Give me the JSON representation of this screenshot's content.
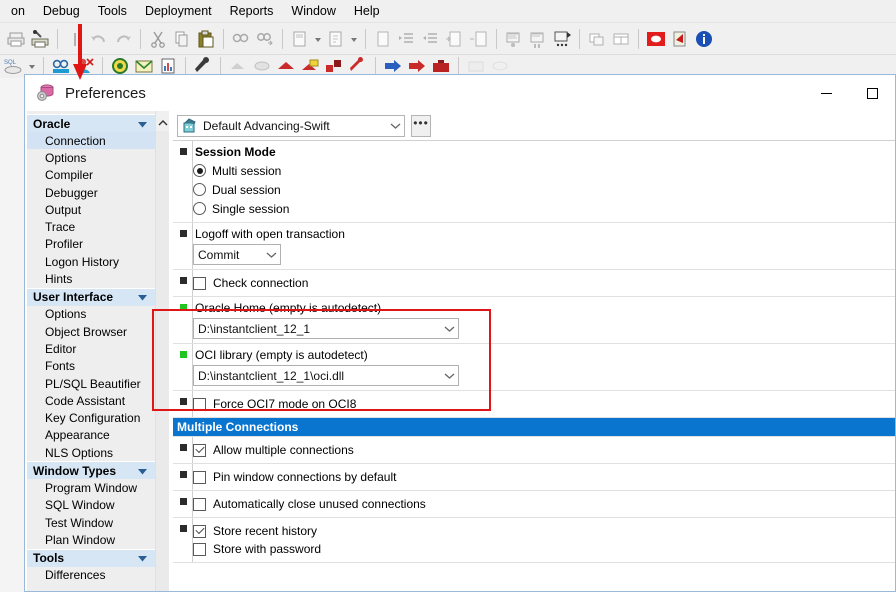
{
  "app": {
    "menubar": [
      {
        "label": "on",
        "truncated": true
      },
      {
        "label": "Debug",
        "accel": "D"
      },
      {
        "label": "Tools",
        "accel": "T"
      },
      {
        "label": "Deployment",
        "accel": "p"
      },
      {
        "label": "Reports",
        "accel": "R"
      },
      {
        "label": "Window",
        "accel": "W"
      },
      {
        "label": "Help",
        "accel": "H"
      }
    ],
    "toolbar_primary_icons": [
      "print-icon",
      "print-setup-icon",
      "separator",
      "sql-bar-icon",
      "undo-icon",
      "redo-icon",
      "separator",
      "cut-icon",
      "copy-icon",
      "paste-icon",
      "separator",
      "find-icon",
      "find-next-icon",
      "separator",
      "new-document-icon",
      "new-document-dropdown-icon",
      "open-document-icon",
      "open-document-dropdown-icon",
      "separator",
      "document-icon",
      "indent-icon",
      "outdent-icon",
      "comment-icon",
      "uncomment-icon",
      "separator",
      "execute-icon",
      "execute-step-icon",
      "execute-options-icon",
      "separator",
      "tile-windows-icon",
      "cascade-windows-icon",
      "separator",
      "oracle-icon",
      "pdf-export-icon",
      "about-icon"
    ],
    "toolbar_secondary_icons": [
      "sql-window-icon",
      "sql-dropdown-icon",
      "separator",
      "find-objects-icon",
      "session-icon",
      "separator",
      "compile-icon",
      "mail-icon",
      "report-icon",
      "separator",
      "tools-wrench-icon",
      "separator",
      "gray-shape-icon",
      "gray-oval-icon",
      "red-object-icon",
      "red-yellow-icon",
      "red-blocks-icon",
      "red-tool-icon",
      "separator",
      "blue-arrow-icon",
      "red-arrow-icon",
      "red-briefcase-icon",
      "separator",
      "faded-icon-a",
      "faded-icon-b"
    ],
    "annotation": {
      "arrow": "red-down-arrow",
      "arrow_color": "#e01515",
      "highlight_box_color": "#e01515"
    }
  },
  "dialog": {
    "title": "Preferences",
    "title_icon": "preferences-database-icon",
    "window_buttons": {
      "minimize": "minimize-icon",
      "maximize": "maximize-icon"
    },
    "profile": {
      "icon": "profile-icon",
      "value": "Default Advancing-Swift",
      "dropdown_icon": "chevron-down-icon",
      "more_button_label": "•••"
    },
    "sidebar": {
      "scroll_up_icon": "chevron-up-icon",
      "groups": [
        {
          "name": "Oracle",
          "caret_icon": "caret-down-icon",
          "items": [
            {
              "label": "Connection",
              "selected": true
            },
            {
              "label": "Options",
              "selected": false
            },
            {
              "label": "Compiler",
              "selected": false
            },
            {
              "label": "Debugger",
              "selected": false
            },
            {
              "label": "Output",
              "selected": false
            },
            {
              "label": "Trace",
              "selected": false
            },
            {
              "label": "Profiler",
              "selected": false
            },
            {
              "label": "Logon History",
              "selected": false
            },
            {
              "label": "Hints",
              "selected": false
            }
          ]
        },
        {
          "name": "User Interface",
          "caret_icon": "caret-down-icon",
          "items": [
            {
              "label": "Options",
              "selected": false
            },
            {
              "label": "Object Browser",
              "selected": false
            },
            {
              "label": "Editor",
              "selected": false
            },
            {
              "label": "Fonts",
              "selected": false
            },
            {
              "label": "PL/SQL Beautifier",
              "selected": false
            },
            {
              "label": "Code Assistant",
              "selected": false
            },
            {
              "label": "Key Configuration",
              "selected": false
            },
            {
              "label": "Appearance",
              "selected": false
            },
            {
              "label": "NLS Options",
              "selected": false
            }
          ]
        },
        {
          "name": "Window Types",
          "caret_icon": "caret-down-icon",
          "items": [
            {
              "label": "Program Window",
              "selected": false
            },
            {
              "label": "SQL Window",
              "selected": false
            },
            {
              "label": "Test Window",
              "selected": false
            },
            {
              "label": "Plan Window",
              "selected": false
            }
          ]
        },
        {
          "name": "Tools",
          "caret_icon": "caret-down-icon",
          "items": [
            {
              "label": "Differences",
              "selected": false
            }
          ]
        }
      ]
    },
    "options": {
      "session_mode": {
        "title": "Session Mode",
        "marker": "black",
        "choices": [
          {
            "label": "Multi session",
            "selected": true
          },
          {
            "label": "Dual session",
            "selected": false
          },
          {
            "label": "Single session",
            "selected": false
          }
        ]
      },
      "logoff": {
        "label": "Logoff with open transaction",
        "marker": "black",
        "value": "Commit",
        "dropdown_icon": "chevron-down-icon"
      },
      "check_connection": {
        "label": "Check connection",
        "marker": "black",
        "checked": false
      },
      "oracle_home": {
        "label": "Oracle Home (empty is autodetect)",
        "marker": "green",
        "value": "D:\\instantclient_12_1",
        "dropdown_icon": "chevron-down-icon"
      },
      "oci_library": {
        "label": "OCI library (empty is autodetect)",
        "marker": "green",
        "value": "D:\\instantclient_12_1\\oci.dll",
        "dropdown_icon": "chevron-down-icon"
      },
      "force_oci7": {
        "label": "Force OCI7 mode on OCI8",
        "marker": "black",
        "checked": false
      },
      "multiple_connections_header": "Multiple Connections",
      "allow_multiple": {
        "label": "Allow multiple connections",
        "marker": "black",
        "checked": true
      },
      "pin_window": {
        "label": "Pin window connections by default",
        "marker": "black",
        "checked": false
      },
      "auto_close": {
        "label": "Automatically close unused connections",
        "marker": "black",
        "checked": false
      },
      "store_history": {
        "label": "Store recent history",
        "marker": "black",
        "checked": true
      },
      "store_password": {
        "label": "Store with password",
        "checked": false
      }
    }
  }
}
